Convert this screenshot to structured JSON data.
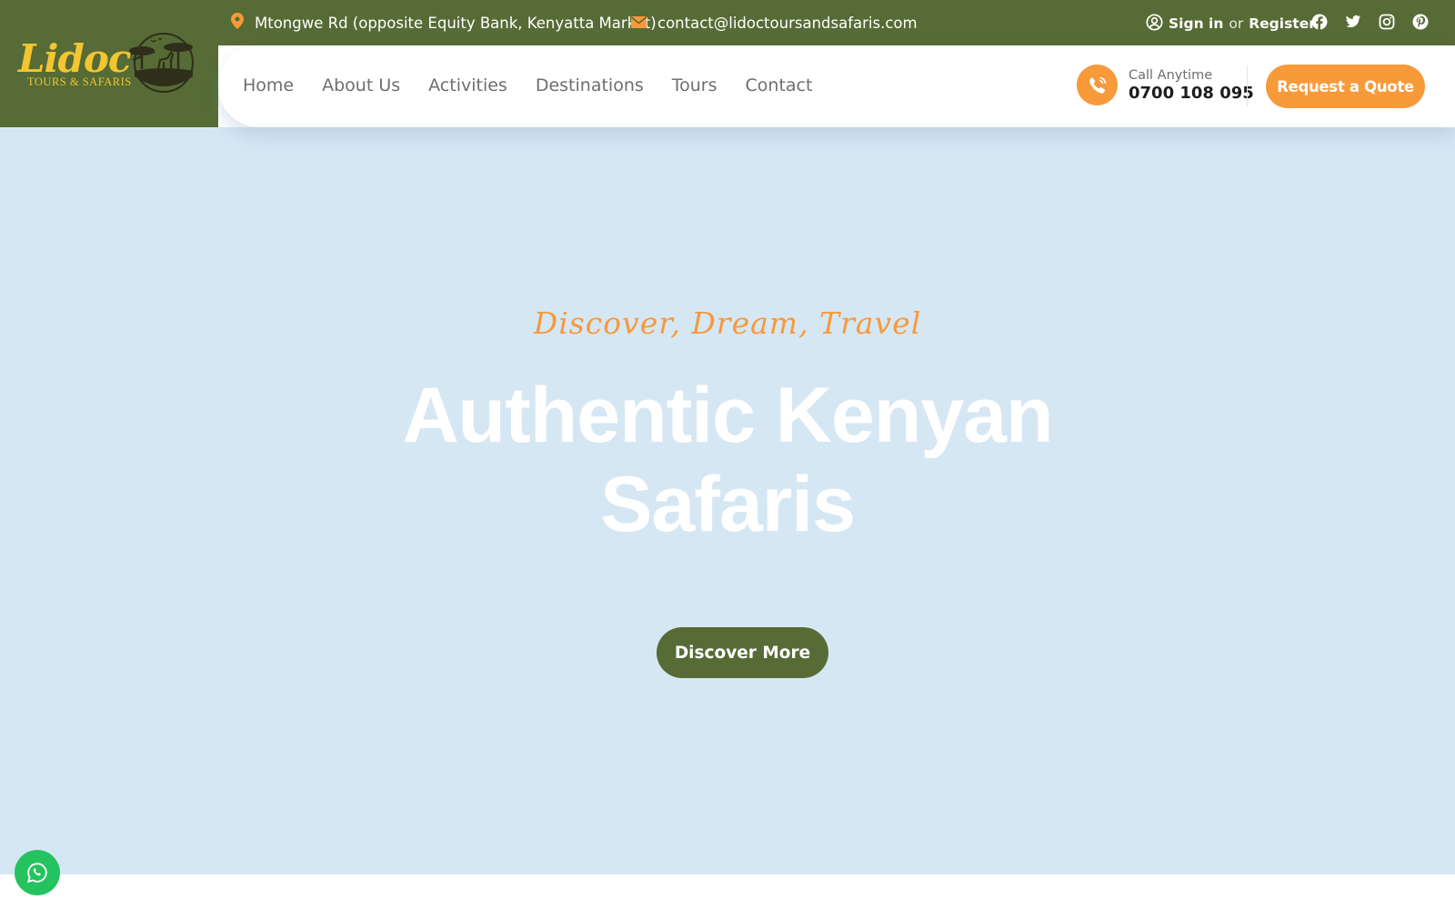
{
  "brand": {
    "name": "Lidoc",
    "subtitle": "TOURS & SAFARIS"
  },
  "topbar": {
    "address": "Mtongwe Rd (opposite Equity Bank, Kenyatta Market)",
    "email": "contact@lidoctoursandsafaris.com",
    "sign_in": "Sign in",
    "or": "or",
    "register": "Register",
    "socials": [
      "facebook-icon",
      "twitter-icon",
      "instagram-icon",
      "pinterest-icon"
    ]
  },
  "nav": {
    "items": [
      {
        "label": "Home"
      },
      {
        "label": "About Us"
      },
      {
        "label": "Activities"
      },
      {
        "label": "Destinations"
      },
      {
        "label": "Tours"
      },
      {
        "label": "Contact"
      }
    ]
  },
  "call": {
    "label": "Call Anytime",
    "number": "0700 108 095"
  },
  "quote_button": "Request a Quote",
  "hero": {
    "tagline": "Discover, Dream, Travel",
    "headline_line1": "Authentic Kenyan",
    "headline_line2": "Safaris",
    "cta": "Discover More"
  },
  "colors": {
    "brand_green": "#566b35",
    "accent_orange": "#f8993a",
    "logo_gold": "#f2c531",
    "hero_bg": "#d6e7f4",
    "whatsapp_green": "#25c360"
  }
}
